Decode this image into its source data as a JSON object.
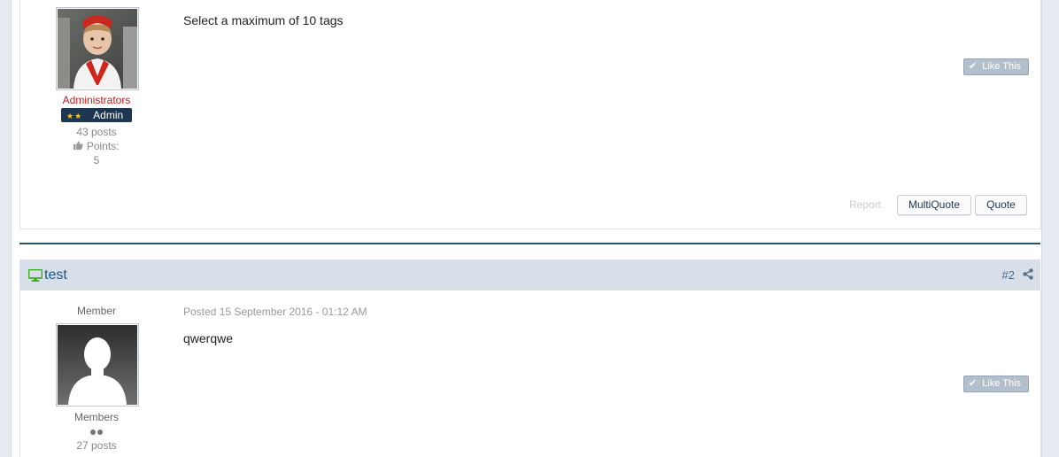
{
  "post1": {
    "author_group": "Administrators",
    "rank_label": "Admin",
    "rank_stars": "★★",
    "posts_count": "43 posts",
    "points_label": "Points:",
    "points_value": "5",
    "body": "Select a maximum of 10 tags",
    "like_label": "Like This",
    "report_label": "Report",
    "multiquote_label": "MultiQuote",
    "quote_label": "Quote"
  },
  "post2": {
    "author_name": "test",
    "post_number": "#2",
    "member_title": "Member",
    "posted_date": "Posted 15 September 2016 - 01:12 AM",
    "body": "qwerqwe",
    "like_label": "Like This",
    "author_group": "Members",
    "posts_count": "27 posts"
  },
  "colors": {
    "accent": "#1d3652",
    "admin_red": "#c4161c",
    "header_bg": "#d8dfe8",
    "separator": "#29566b",
    "online_green": "#3fae29"
  },
  "icons": {
    "online": "monitor-icon",
    "share": "share-icon",
    "like": "check-icon",
    "points": "thumbs-up-icon"
  }
}
